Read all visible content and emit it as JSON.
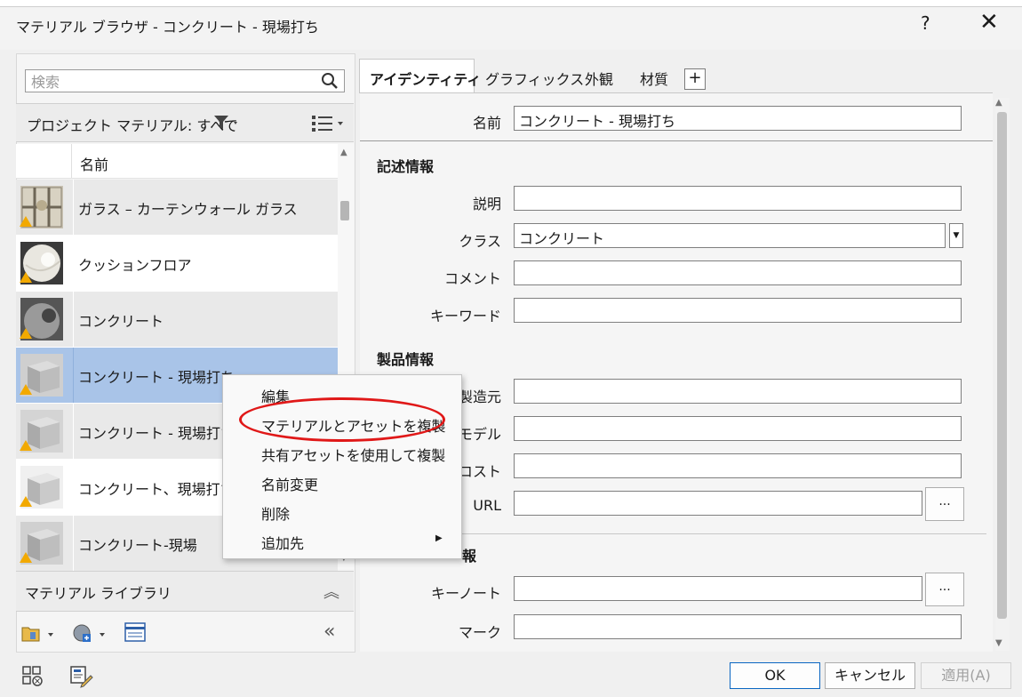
{
  "window": {
    "title": "マテリアル ブラウザ - コンクリート - 現場打ち",
    "help": "?",
    "close": "✕"
  },
  "search": {
    "placeholder": "検索"
  },
  "project": {
    "label": "プロジェクト マテリアル: すべて"
  },
  "list": {
    "header_name": "名前",
    "items": [
      {
        "label": "ガラス – カーテンウォール ガラス",
        "thumb": "glass-curtain"
      },
      {
        "label": "クッションフロア",
        "thumb": "cushion-floor"
      },
      {
        "label": "コンクリート",
        "thumb": "concrete-sphere"
      },
      {
        "label": "コンクリート - 現場打ち",
        "thumb": "concrete-cube",
        "selected": true
      },
      {
        "label": "コンクリート - 現場打ち",
        "thumb": "concrete-cube-2"
      },
      {
        "label": "コンクリート、現場打ちク",
        "thumb": "concrete-cube-3"
      },
      {
        "label": "コンクリート-現場",
        "thumb": "concrete-cube-4"
      }
    ]
  },
  "library": {
    "label": "マテリアル ライブラリ"
  },
  "tabs": {
    "identity": "アイデンティティ",
    "graphics": "グラフィックス",
    "appearance": "外観",
    "physical": "材質",
    "add": "+"
  },
  "identity": {
    "name_label": "名前",
    "name_value": "コンクリート - 現場打ち",
    "desc_section": "記述情報",
    "description_label": "説明",
    "description_value": "",
    "class_label": "クラス",
    "class_value": "コンクリート",
    "comment_label": "コメント",
    "comment_value": "",
    "keyword_label": "キーワード",
    "keyword_value": "",
    "product_section": "製品情報",
    "manufacturer_label": "製造元",
    "model_label": "モデル",
    "cost_label": "コスト",
    "url_label": "URL",
    "browse": "...",
    "annotation_section_tail": "報",
    "keynote_label": "キーノート",
    "mark_label": "マーク"
  },
  "context_menu": {
    "edit": "編集",
    "duplicate_with_assets": "マテリアルとアセットを複製",
    "duplicate_shared": "共有アセットを使用して複製",
    "rename": "名前変更",
    "delete": "削除",
    "add_to": "追加先"
  },
  "buttons": {
    "ok": "OK",
    "cancel": "キャンセル",
    "apply": "適用(A)"
  },
  "colors": {
    "selection": "#a9c4e8",
    "highlight_oval": "#e01818",
    "warning": "#f2a900",
    "ok_border": "#0a66c2"
  }
}
